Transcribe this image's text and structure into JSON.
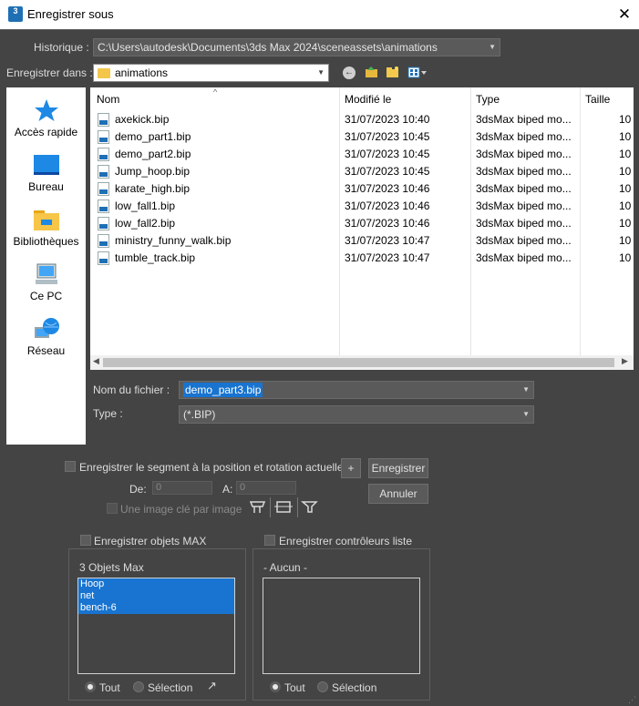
{
  "window": {
    "title": "Enregistrer sous",
    "close_glyph": "✕",
    "app_icon_text": "3"
  },
  "history": {
    "label": "Historique :",
    "value": "C:\\Users\\autodesk\\Documents\\3ds Max 2024\\sceneassets\\animations"
  },
  "save_in": {
    "label": "Enregistrer dans :",
    "value": "animations"
  },
  "places": [
    {
      "label": "Accès rapide",
      "icon": "star-icon"
    },
    {
      "label": "Bureau",
      "icon": "desktop-icon"
    },
    {
      "label": "Bibliothèques",
      "icon": "libraries-folder-icon"
    },
    {
      "label": "Ce PC",
      "icon": "computer-icon"
    },
    {
      "label": "Réseau",
      "icon": "network-globe-icon"
    }
  ],
  "columns": {
    "name": "Nom",
    "modified": "Modifié le",
    "type": "Type",
    "size": "Taille"
  },
  "files": [
    {
      "name": "axekick.bip",
      "modified": "31/07/2023 10:40",
      "type": "3dsMax biped mo...",
      "size": "10"
    },
    {
      "name": "demo_part1.bip",
      "modified": "31/07/2023 10:45",
      "type": "3dsMax biped mo...",
      "size": "10"
    },
    {
      "name": "demo_part2.bip",
      "modified": "31/07/2023 10:45",
      "type": "3dsMax biped mo...",
      "size": "10"
    },
    {
      "name": "Jump_hoop.bip",
      "modified": "31/07/2023 10:45",
      "type": "3dsMax biped mo...",
      "size": "10"
    },
    {
      "name": "karate_high.bip",
      "modified": "31/07/2023 10:46",
      "type": "3dsMax biped mo...",
      "size": "10"
    },
    {
      "name": "low_fall1.bip",
      "modified": "31/07/2023 10:46",
      "type": "3dsMax biped mo...",
      "size": "10"
    },
    {
      "name": "low_fall2.bip",
      "modified": "31/07/2023 10:46",
      "type": "3dsMax biped mo...",
      "size": "10"
    },
    {
      "name": "ministry_funny_walk.bip",
      "modified": "31/07/2023 10:47",
      "type": "3dsMax biped mo...",
      "size": "10"
    },
    {
      "name": "tumble_track.bip",
      "modified": "31/07/2023 10:47",
      "type": "3dsMax biped mo...",
      "size": "10"
    }
  ],
  "filename": {
    "label": "Nom du fichier :",
    "value": "demo_part3.bip"
  },
  "filetype": {
    "label": "Type :",
    "value": "(*.BIP)"
  },
  "segment": {
    "checkbox_label": "Enregistrer le segment à la position et rotation actuelles",
    "from_label": "De:",
    "from_value": "0",
    "to_label": "A:",
    "to_value": "0",
    "keyframe_label": "Une image clé par image",
    "plus": "+"
  },
  "buttons": {
    "save": "Enregistrer",
    "cancel": "Annuler"
  },
  "max_objects": {
    "checkbox_label": "Enregistrer objets MAX",
    "title": "3 Objets Max",
    "items": [
      "Hoop",
      "net",
      "bench-6"
    ],
    "radio_all": "Tout",
    "radio_selection": "Sélection"
  },
  "list_controllers": {
    "checkbox_label": "Enregistrer contrôleurs liste",
    "title": "- Aucun -",
    "radio_all": "Tout",
    "radio_selection": "Sélection"
  },
  "colors": {
    "background": "#444444",
    "selection": "#1874d0",
    "biped_icon": "#1f6fb5"
  }
}
